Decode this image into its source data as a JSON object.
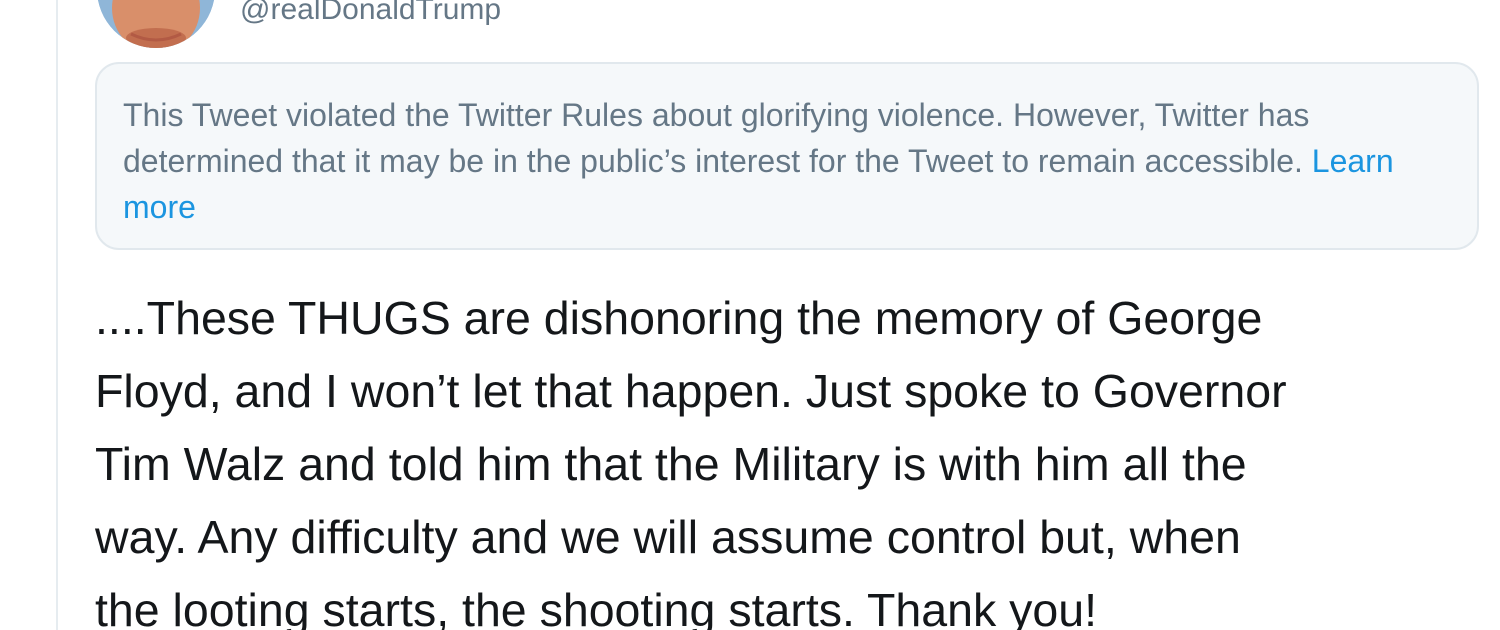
{
  "tweet": {
    "handle": "@realDonaldTrump",
    "notice": {
      "text": "This Tweet violated the Twitter Rules about glorifying violence. However, Twitter has determined that it may be in the public’s interest for the Tweet to remain accessible.",
      "link_label": "Learn more"
    },
    "lines": [
      "....These THUGS are dishonoring the memory of George",
      "Floyd, and I won’t let that happen. Just spoke to Governor",
      "Tim Walz and told him that the Military is with him all the",
      "way. Any difficulty and we will assume control but, when",
      "the looting starts, the shooting starts. Thank you!"
    ]
  },
  "colors": {
    "text_primary": "#14171a",
    "text_secondary": "#657786",
    "link": "#1b95e0",
    "notice_background": "#f5f8fa",
    "notice_border": "#e1e8ed"
  }
}
